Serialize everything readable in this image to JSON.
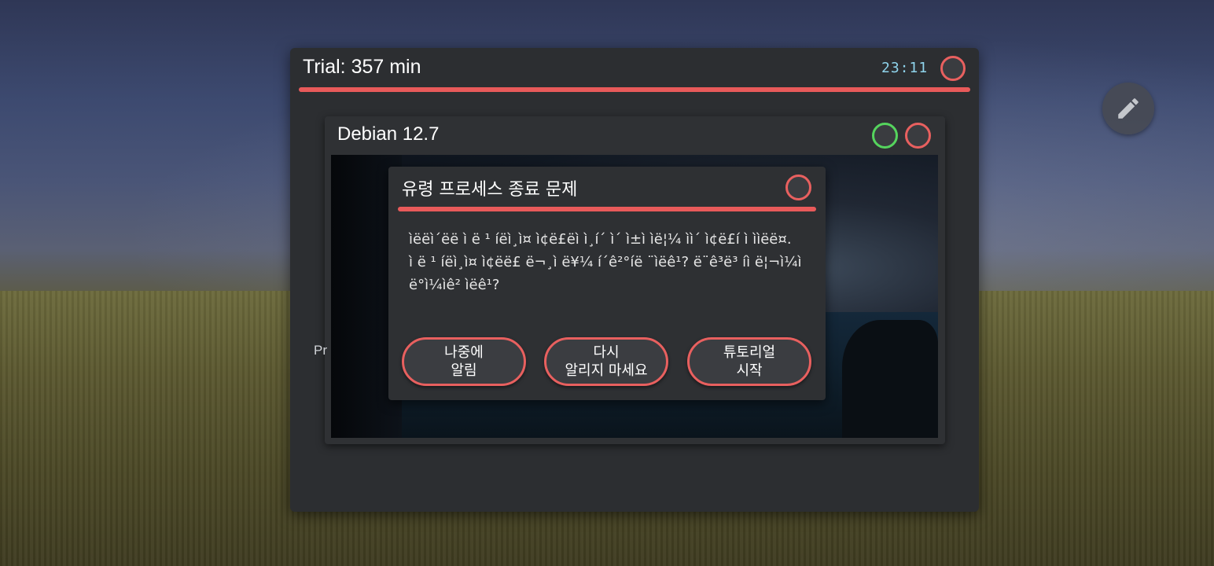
{
  "outer_window": {
    "title": "Trial: 357 min",
    "clock": "23:11"
  },
  "inner_window": {
    "title": "Debian 12.7",
    "side_label": "Pr"
  },
  "dialog": {
    "title": "유령 프로세스 종료 문제",
    "body": "ìëëì´ëë ì ë ¹ íëì¸ì¤ ì¢ë£ëì ì¸í´ ì´ ì±ì ìë¦¼ ìì´ ì¢ë£í ì ììëë¤.\nì ë ¹ íëì¸ì¤ ì¢ëë£ ë¬¸ì ë¥¼ í´ê²°íë ¨ìëê¹? ë¨ê³ë³ íì ë¦¬ì¼ì ë°ì¼ìê² ìëê¹?",
    "buttons": {
      "later": "나중에\n알림",
      "dont_remind": "다시\n알리지 마세요",
      "tutorial": "튜토리얼\n시작"
    }
  },
  "colors": {
    "accent_red": "#e85a5a",
    "accent_green": "#55d45d",
    "clock_cyan": "#8fd4ec"
  },
  "icons": {
    "edit": "pencil-icon"
  }
}
